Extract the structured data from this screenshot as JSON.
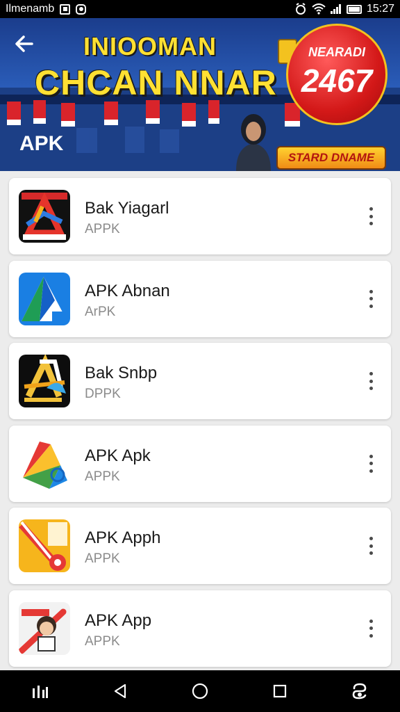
{
  "status_bar": {
    "carrier": "Ilmenamb",
    "time": "15:27",
    "icons": [
      "sim-icon",
      "notification-icon",
      "alarm-icon",
      "wifi-icon",
      "signal-icon",
      "battery-icon"
    ]
  },
  "banner": {
    "headline_line1": "INIOOMAN",
    "headline_line2": "CHCAN NNAR",
    "badge_label": "NEARADI",
    "badge_number": "2467",
    "ribbon_text": "STARD DNAME",
    "page_title": "APK",
    "colors": {
      "background": "#2a5cb8",
      "headline": "#ffe033",
      "badge": "#d31818",
      "ribbon": "#ffd230"
    }
  },
  "apps": [
    {
      "name": "Bak Yiagarl",
      "subtitle": "APPK",
      "icon": "app-icon-a-red-blue"
    },
    {
      "name": "APK Abnan",
      "subtitle": "ArPK",
      "icon": "app-icon-a-blue"
    },
    {
      "name": "Bak Snbp",
      "subtitle": "DPPK",
      "icon": "app-icon-a-gold"
    },
    {
      "name": "APK Apk",
      "subtitle": "APPK",
      "icon": "app-icon-map-multicolor"
    },
    {
      "name": "APK Apph",
      "subtitle": "APPK",
      "icon": "app-icon-yellow-red"
    },
    {
      "name": "APK App",
      "subtitle": "APPK",
      "icon": "app-icon-cartoon"
    }
  ],
  "nav_bar": {
    "icons": [
      "recent-apps-bars-icon",
      "back-triangle-icon",
      "home-circle-icon",
      "overview-square-icon",
      "assistant-icon"
    ]
  }
}
